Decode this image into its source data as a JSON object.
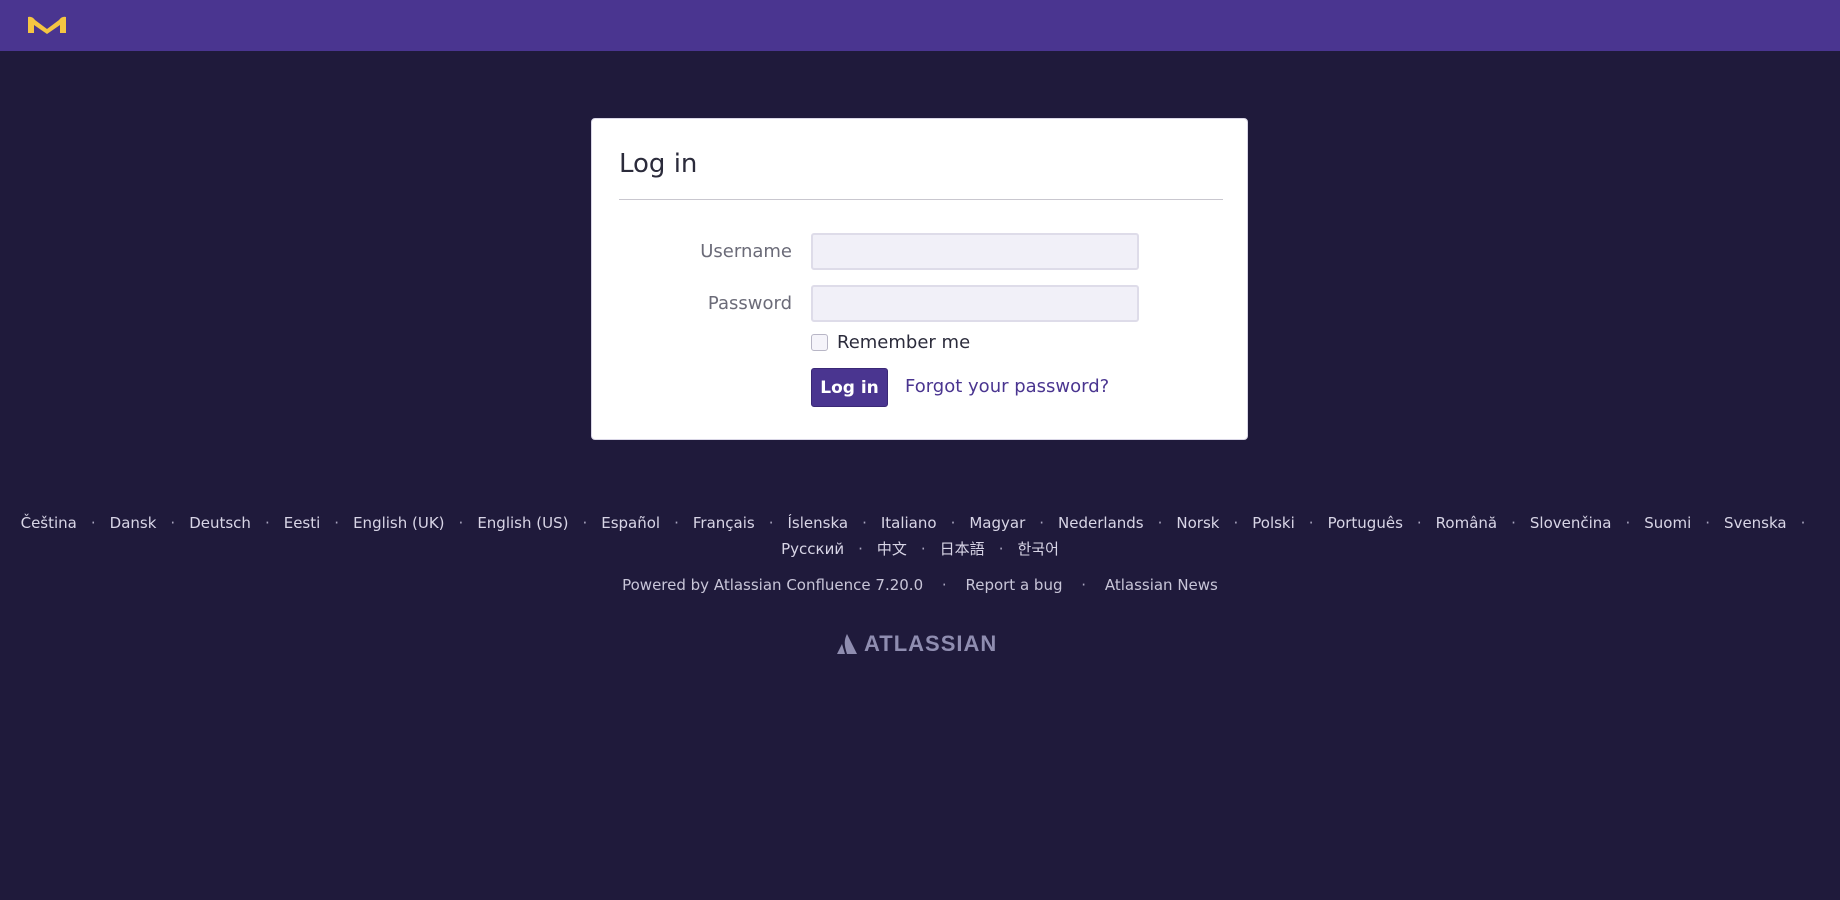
{
  "header": {
    "logo_icon": "m-brand-logo-icon",
    "accent_color": "#f5c542",
    "bar_color": "#4a3590"
  },
  "login": {
    "title": "Log in",
    "username_label": "Username",
    "password_label": "Password",
    "username_value": "",
    "password_value": "",
    "remember_label": "Remember me",
    "remember_checked": false,
    "submit_label": "Log in",
    "forgot_label": "Forgot your password?"
  },
  "languages": {
    "row1": [
      "Čeština",
      "Dansk",
      "Deutsch",
      "Eesti",
      "English (UK)",
      "English (US)",
      "Español",
      "Français",
      "Íslenska",
      "Italiano",
      "Magyar",
      "Nederlands",
      "Norsk",
      "Polski",
      "Português",
      "Română",
      "Slovenčina",
      "Suomi",
      "Svenska"
    ],
    "row2": [
      "Русский",
      "中文",
      "日本語",
      "한국어"
    ],
    "separator": "·"
  },
  "footer": {
    "powered_by": "Powered by Atlassian Confluence 7.20.0",
    "report_bug": "Report a bug",
    "news": "Atlassian News",
    "separator": "·",
    "brand": "ATLASSIAN",
    "brand_icon": "atlassian-logo-icon"
  }
}
